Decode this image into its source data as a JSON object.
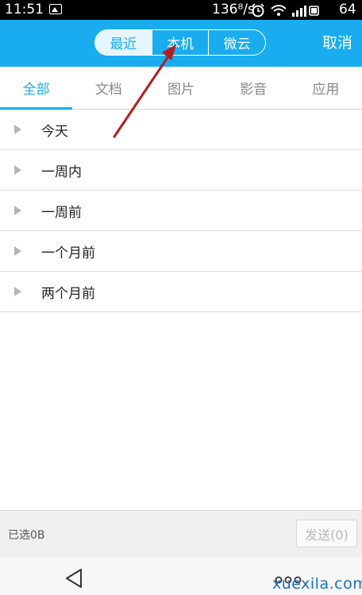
{
  "status_bar": {
    "time": "11:51",
    "speed": "136⁸/s",
    "battery": "64"
  },
  "titlebar": {
    "segments": [
      "最近",
      "本机",
      "微云"
    ],
    "cancel": "取消",
    "accent_color": "#19adef"
  },
  "tabs": [
    "全部",
    "文档",
    "图片",
    "影音",
    "应用"
  ],
  "list": [
    "今天",
    "一周内",
    "一周前",
    "一个月前",
    "两个月前"
  ],
  "footer": {
    "selected": "已选0B",
    "send": "发送(0)"
  },
  "watermark": "xuexila.com"
}
